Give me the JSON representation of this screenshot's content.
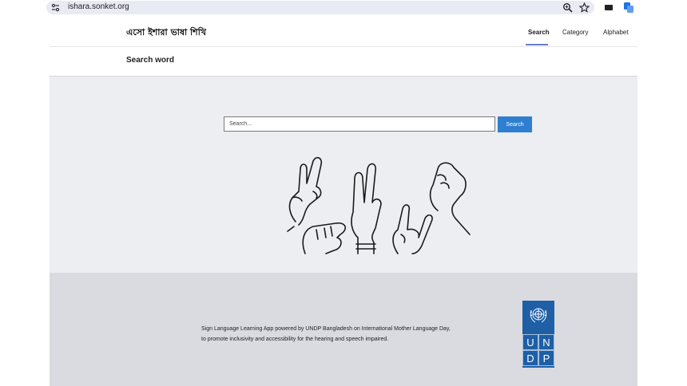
{
  "browser": {
    "url": "ishara.sonket.org"
  },
  "header": {
    "brand": "এসো ইশারা ভাষা শিখি",
    "nav": [
      "Search",
      "Category",
      "Alphabet"
    ],
    "active_nav": "Search"
  },
  "subheader": {
    "title": "Search word"
  },
  "search": {
    "placeholder": "Search...",
    "button_label": "Search"
  },
  "footer": {
    "line1": "Sign Language Learning App powered by UNDP Bangladesh on International Mother Language Day,",
    "line2": "to promote inclusivity and accessibility for the hearing and speech impaired.",
    "logo_letters": [
      "U",
      "N",
      "D",
      "P"
    ]
  },
  "colors": {
    "accent": "#2f7fd0",
    "undp_blue": "#1e5fa6",
    "hero_bg": "#eceef2",
    "footer_bg": "#d9dbe0",
    "nav_underline": "#6b7cc9"
  },
  "icons": [
    "site-info-icon",
    "zoom-icon",
    "star-icon",
    "extension-icon",
    "translate-icon",
    "un-emblem-icon"
  ]
}
